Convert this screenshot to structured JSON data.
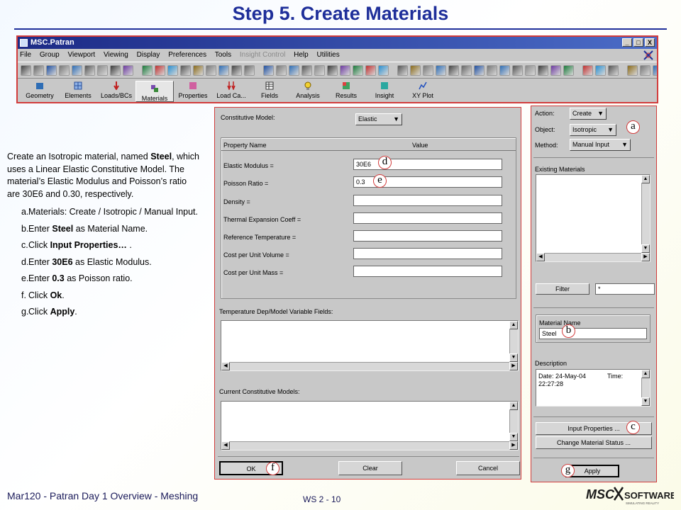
{
  "slide": {
    "title": "Step 5.  Create Materials"
  },
  "patran": {
    "title": "MSC.Patran",
    "window_buttons": [
      "_",
      "□",
      "X"
    ],
    "menu": [
      "File",
      "Group",
      "Viewport",
      "Viewing",
      "Display",
      "Preferences",
      "Tools",
      "Insight Control",
      "Help",
      "Utilities"
    ],
    "disabled_menu": "Insight Control",
    "apps": [
      "Geometry",
      "Elements",
      "Loads/BCs",
      "Materials",
      "Properties",
      "Load Ca...",
      "Fields",
      "Analysis",
      "Results",
      "Insight",
      "XY Plot"
    ],
    "active_app": "Materials"
  },
  "instructions": {
    "intro": {
      "before_bold": "Create an Isotropic material, named ",
      "bold": "Steel",
      "after_bold": ", which uses a Linear Elastic Constitutive Model.  The material’s Elastic Modulus and Poisson’s ratio are 30E6 and 0.30, respectively."
    },
    "steps": [
      {
        "letter": "a.",
        "text": "Materials: Create / Isotropic / Manual Input."
      },
      {
        "letter": "b.",
        "pre": "Enter ",
        "bold": "Steel",
        "post": " as Material Name."
      },
      {
        "letter": "c.",
        "pre": "Click ",
        "bold": "Input Properties…",
        "post": " ."
      },
      {
        "letter": "d.",
        "pre": "Enter ",
        "bold": "30E6",
        "post": " as Elastic Modulus."
      },
      {
        "letter": "e.",
        "pre": "Enter ",
        "bold": "0.3",
        "post": " as Poisson ratio."
      },
      {
        "letter": "f.",
        "pre": "Click ",
        "bold": "Ok",
        "post": "."
      },
      {
        "letter": "g.",
        "pre": "Click ",
        "bold": "Apply",
        "post": "."
      }
    ]
  },
  "input_dialog": {
    "constitutive_label": "Constitutive Model:",
    "constitutive_value": "Elastic",
    "col_property": "Property Name",
    "col_value": "Value",
    "rows": [
      {
        "name": "Elastic Modulus =",
        "value": "30E6"
      },
      {
        "name": "Poisson Ratio =",
        "value": "0.3"
      },
      {
        "name": "Density =",
        "value": ""
      },
      {
        "name": "Thermal Expansion Coeff =",
        "value": ""
      },
      {
        "name": "Reference Temperature =",
        "value": ""
      },
      {
        "name": "Cost per Unit Volume =",
        "value": ""
      },
      {
        "name": "Cost per Unit Mass =",
        "value": ""
      }
    ],
    "temp_dep_label": "Temperature Dep/Model Variable Fields:",
    "current_models_label": "Current Constitutive Models:",
    "ok": "OK",
    "clear": "Clear",
    "cancel": "Cancel"
  },
  "materials_form": {
    "action_label": "Action:",
    "action_value": "Create",
    "object_label": "Object:",
    "object_value": "Isotropic",
    "method_label": "Method:",
    "method_value": "Manual Input",
    "existing_label": "Existing Materials",
    "filter_button": "Filter",
    "filter_value": "*",
    "material_name_label": "Material Name",
    "material_name_value": "Steel",
    "description_label": "Description",
    "description_line1": "Date: 24-May-04",
    "description_time": "Time:",
    "description_line2": "22:27:28",
    "input_properties_button": "Input Properties ...",
    "change_status_button": "Change Material Status ...",
    "apply_button": "Apply"
  },
  "callouts": {
    "a": "a",
    "b": "b",
    "c": "c",
    "d": "d",
    "e": "e",
    "f": "f",
    "g": "g"
  },
  "footer": {
    "left": "Mar120 - Patran Day 1 Overview - Meshing",
    "page": "WS 2 - 10",
    "logo_main": "MSC",
    "logo_software": "SOFTWARE",
    "logo_tagline": "SIMULATING REALITY"
  },
  "colors": {
    "title": "#1f2f9a",
    "accent_border": "#d23c3c",
    "panel": "#c8c8c8",
    "titlebar": "#1c2a86"
  }
}
